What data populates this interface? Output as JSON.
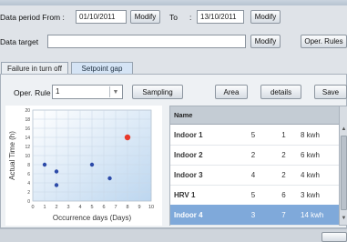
{
  "filters": {
    "data_period_from_label": "Data period From :",
    "from_date": "01/10/2011",
    "modify_label": "Modify",
    "to_label": "To",
    "to_colon": ":",
    "to_date": "13/10/2011",
    "data_target_label": "Data target",
    "data_target_value": "",
    "oper_rules_label": "Oper. Rules"
  },
  "tabs": [
    {
      "label": "Failure in turn off",
      "active": false
    },
    {
      "label": "Setpoint gap",
      "active": true
    }
  ],
  "toolbar": {
    "oper_rule_label": "Oper. Rule",
    "oper_rule_value": "1",
    "sampling_label": "Sampling",
    "area_label": "Area",
    "details_label": "details",
    "save_label": "Save"
  },
  "chart_data": {
    "type": "scatter",
    "title": "",
    "xlabel": "Occurrence days (Days)",
    "ylabel": "Actual Time (h)",
    "xlim": [
      0,
      10
    ],
    "ylim": [
      0,
      20
    ],
    "xticks": [
      0,
      1,
      2,
      3,
      4,
      5,
      6,
      7,
      8,
      9,
      10
    ],
    "yticks": [
      0,
      2,
      4,
      6,
      8,
      10,
      12,
      14,
      16,
      18,
      20
    ],
    "grid": true,
    "series": [
      {
        "points": [
          {
            "x": 1,
            "y": 8,
            "color": "#2c4aa8"
          },
          {
            "x": 2,
            "y": 6.5,
            "color": "#2c4aa8"
          },
          {
            "x": 2,
            "y": 3.5,
            "color": "#2c4aa8"
          },
          {
            "x": 5,
            "y": 8,
            "color": "#2c4aa8"
          },
          {
            "x": 6.5,
            "y": 5,
            "color": "#2c4aa8"
          },
          {
            "x": 8,
            "y": 14,
            "color": "#e8392b"
          }
        ]
      }
    ]
  },
  "table": {
    "header": "Name",
    "rows": [
      {
        "name": "Indoor 1",
        "c1": "5",
        "c2": "1",
        "value": "8 kwh",
        "selected": false
      },
      {
        "name": "Indoor 2",
        "c1": "2",
        "c2": "2",
        "value": "6 kwh",
        "selected": false
      },
      {
        "name": "Indoor 3",
        "c1": "4",
        "c2": "2",
        "value": "4 kwh",
        "selected": false
      },
      {
        "name": "HRV 1",
        "c1": "5",
        "c2": "6",
        "value": "3 kwh",
        "selected": false
      },
      {
        "name": "Indoor 4",
        "c1": "3",
        "c2": "7",
        "value": "14 kwh",
        "selected": true
      }
    ]
  },
  "colors": {
    "accent": "#7fa9da",
    "selected_row": "#7fa9da",
    "outlier_point": "#e8392b",
    "normal_point": "#2c4aa8"
  }
}
